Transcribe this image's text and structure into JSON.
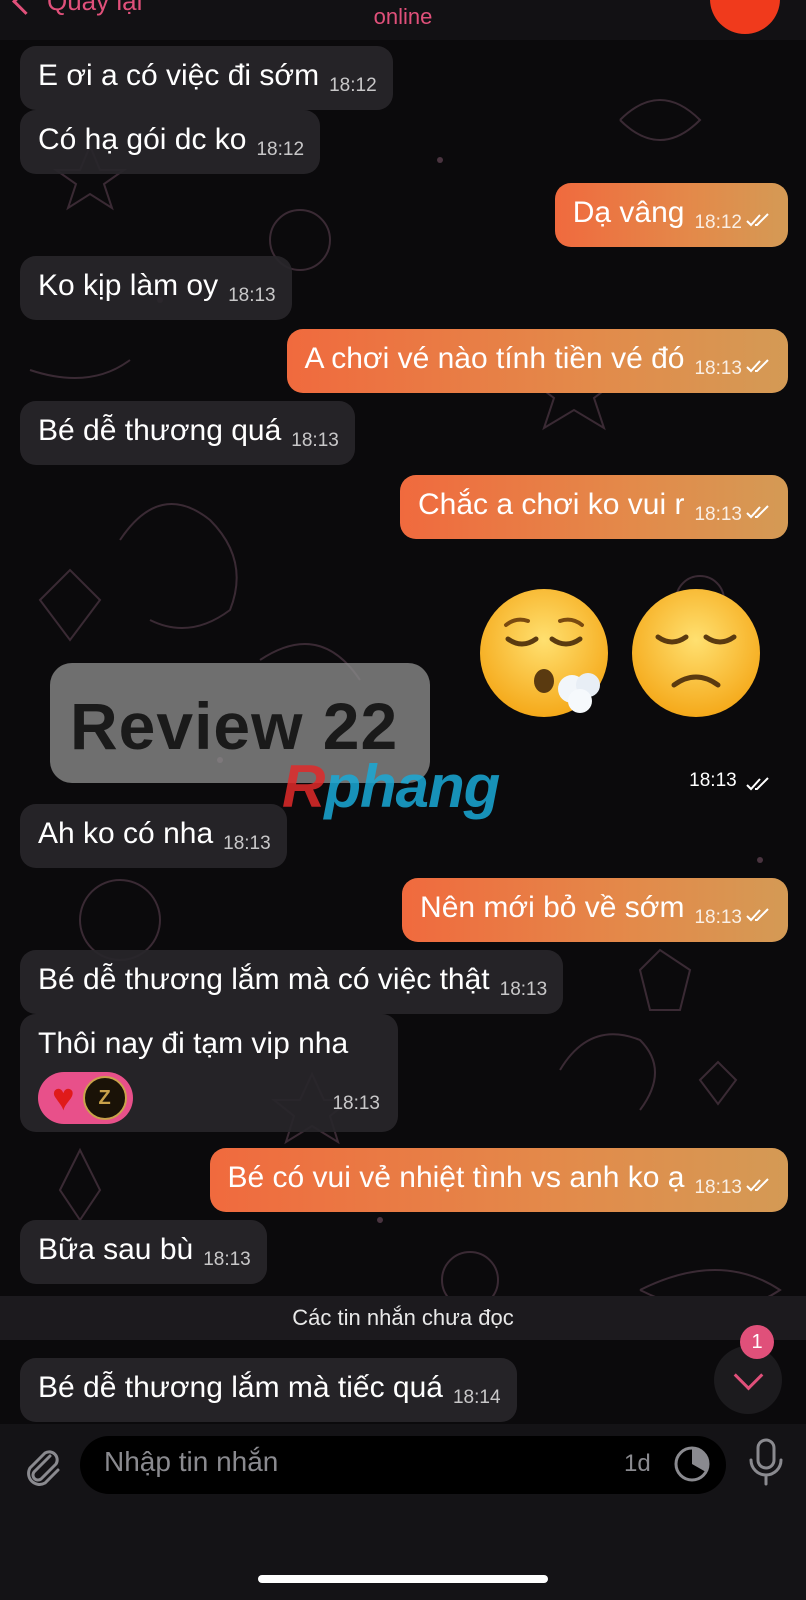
{
  "header": {
    "back_label": "Quay lại",
    "status": "online",
    "avatar_color": "#f03a1c"
  },
  "messages": [
    {
      "dir": "in",
      "text": "E ơi a có việc đi sớm",
      "time": "18:12"
    },
    {
      "dir": "in",
      "text": "Có hạ gói dc ko",
      "time": "18:12"
    },
    {
      "dir": "out",
      "text": "Dạ vâng",
      "time": "18:12"
    },
    {
      "dir": "in",
      "text": "Ko kịp làm oy",
      "time": "18:13"
    },
    {
      "dir": "out",
      "text": "A chơi vé nào tính tiền vé đó",
      "time": "18:13"
    },
    {
      "dir": "in",
      "text": "Bé dễ thương quá",
      "time": "18:13"
    },
    {
      "dir": "out",
      "text": "Chắc a chơi ko vui r",
      "time": "18:13"
    },
    {
      "dir": "out",
      "kind": "sticker",
      "emojis": [
        "😮‍💨",
        "😞"
      ],
      "time": "18:13"
    },
    {
      "dir": "in",
      "text": "Ah ko có nha",
      "time": "18:13"
    },
    {
      "dir": "out",
      "text": "Nên mới bỏ về sớm",
      "time": "18:13"
    },
    {
      "dir": "in",
      "text": "Bé dễ thương lắm mà có việc thật",
      "time": "18:13"
    },
    {
      "dir": "in",
      "text": "Thôi nay đi tạm vip nha",
      "time": "18:13",
      "reactions": [
        "heart-icon",
        "z-badge"
      ]
    },
    {
      "dir": "out",
      "text": "Bé có vui vẻ nhiệt tình vs anh ko ạ",
      "time": "18:13"
    },
    {
      "dir": "in",
      "text": "Bữa sau bù",
      "time": "18:13"
    },
    {
      "dir": "in",
      "text": "Bé dễ thương lắm mà tiếc quá",
      "time": "18:14"
    }
  ],
  "watermark": {
    "text": "Review 22",
    "brand_r": "R",
    "brand_rest": "phang"
  },
  "reaction_badge_letter": "Z",
  "unread_divider": "Các tin nhắn chưa đọc",
  "scroll_down": {
    "unread_count": "1"
  },
  "input": {
    "placeholder": "Nhập tin nhắn",
    "timer_label": "1d"
  },
  "colors": {
    "accent": "#e0507a",
    "incoming_bubble": "#28262a",
    "outgoing_start": "#f06a3e",
    "outgoing_end": "#d49a55"
  }
}
